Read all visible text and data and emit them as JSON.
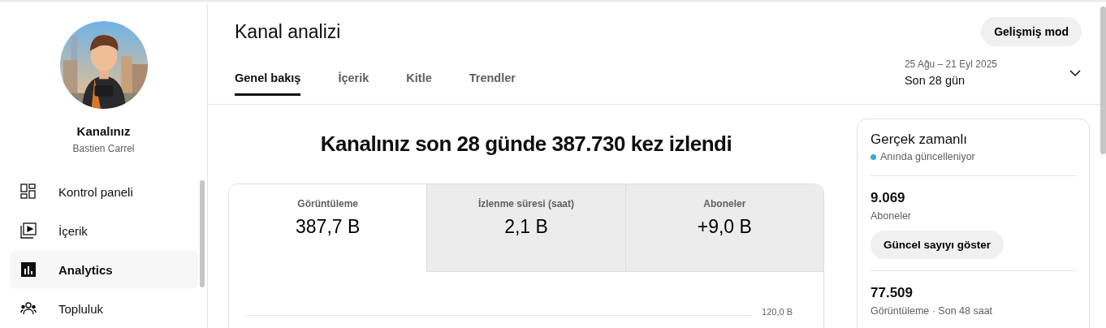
{
  "sidebar": {
    "channel_title": "Kanalınız",
    "channel_name": "Bastien Carrel",
    "items": [
      {
        "label": "Kontrol paneli",
        "kind": "dashboard",
        "selected": false
      },
      {
        "label": "İçerik",
        "kind": "content",
        "selected": false
      },
      {
        "label": "Analytics",
        "kind": "analytics",
        "selected": true
      },
      {
        "label": "Topluluk",
        "kind": "community",
        "selected": false
      }
    ]
  },
  "header": {
    "title": "Kanal analizi",
    "advanced_button": "Gelişmiş mod",
    "tabs": [
      {
        "label": "Genel bakış",
        "selected": true
      },
      {
        "label": "İçerik",
        "selected": false
      },
      {
        "label": "Kitle",
        "selected": false
      },
      {
        "label": "Trendler",
        "selected": false
      }
    ],
    "date_range": {
      "dates": "25 Ağu – 21 Eyl 2025",
      "label": "Son 28 gün"
    }
  },
  "summary": {
    "headline": "Kanalınız son 28 günde 387.730 kez izlendi",
    "metrics": [
      {
        "label": "Görüntüleme",
        "value": "387,7 B",
        "selected": true
      },
      {
        "label": "İzlenme süresi (saat)",
        "value": "2,1 B",
        "selected": false
      },
      {
        "label": "Aboneler",
        "value": "+9,0 B",
        "selected": false
      }
    ],
    "chart": {
      "axis_label": "120,0 B"
    }
  },
  "realtime": {
    "title": "Gerçek zamanlı",
    "status": "Anında güncelleniyor",
    "subscribers": "9.069",
    "subscribers_label": "Aboneler",
    "show_button": "Güncel sayıyı göster",
    "views": "77.509",
    "views_label": "Görüntüleme · Son 48 saat"
  }
}
